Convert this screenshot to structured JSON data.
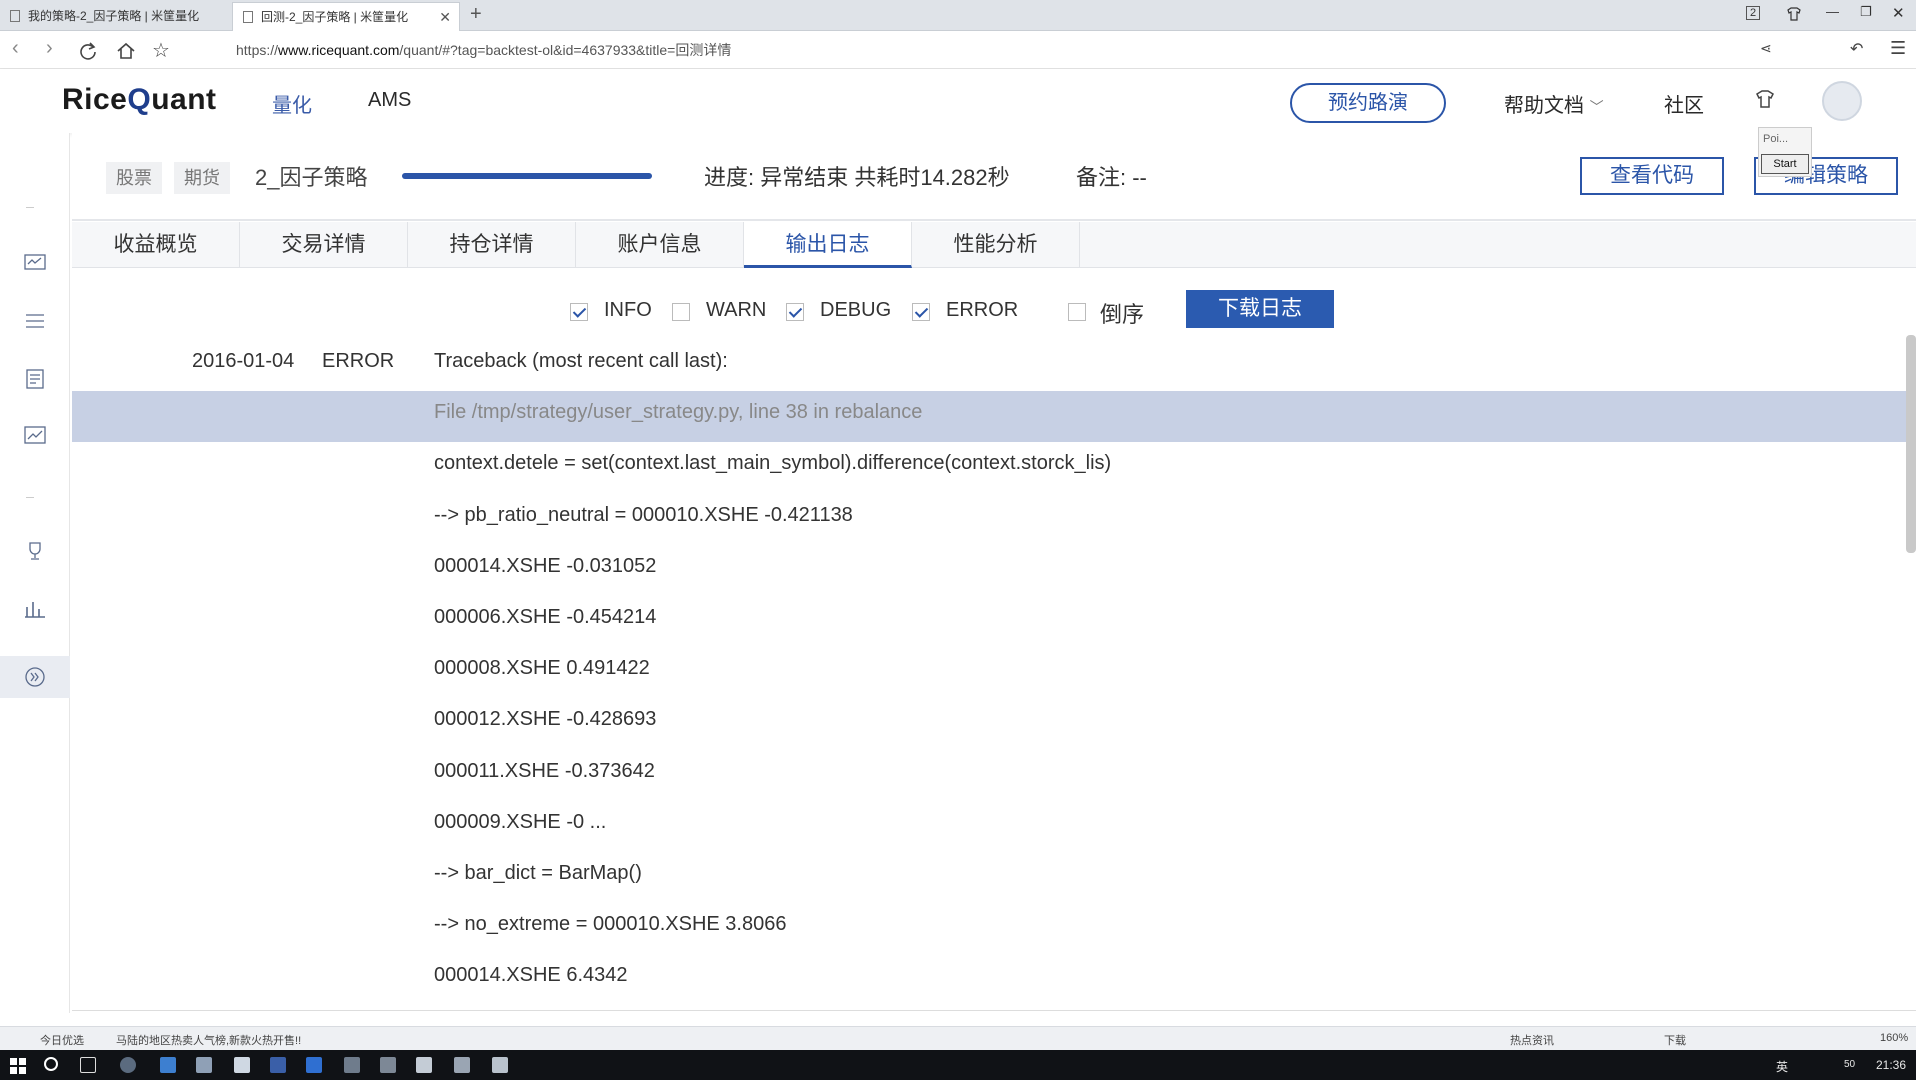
{
  "browser": {
    "tabs": [
      {
        "title": "我的策略-2_因子策略 | 米筐量化",
        "active": false
      },
      {
        "title": "回测-2_因子策略 | 米筐量化",
        "active": true
      }
    ],
    "url_prefix": "https://",
    "url_domain": "www.ricequant.com",
    "url_rest": "/quant/#?tag=backtest-ol&id=4637933&title=回测详情",
    "win_badge": "2"
  },
  "header": {
    "logo_rice": "Rice",
    "logo_q": "Q",
    "logo_uant": "uant",
    "nav": [
      "量化",
      "AMS"
    ],
    "demo_button": "预约路演",
    "help_docs": "帮助文档",
    "community": "社区"
  },
  "overlay_widget": {
    "top_label": "Poi...",
    "button": "Start"
  },
  "strategy": {
    "type_stock": "股票",
    "type_futures": "期货",
    "name": "2_因子策略",
    "progress_fraction": 1.0,
    "progress_text": "进度: 异常结束 共耗时14.282秒",
    "remark": "备注: --",
    "view_code": "查看代码",
    "edit_strategy": "编辑策略"
  },
  "tabs": [
    {
      "label": "收益概览",
      "active": false
    },
    {
      "label": "交易详情",
      "active": false
    },
    {
      "label": "持仓详情",
      "active": false
    },
    {
      "label": "账户信息",
      "active": false
    },
    {
      "label": "输出日志",
      "active": true
    },
    {
      "label": "性能分析",
      "active": false
    }
  ],
  "filters": [
    {
      "label": "INFO",
      "checked": true
    },
    {
      "label": "WARN",
      "checked": false
    },
    {
      "label": "DEBUG",
      "checked": true
    },
    {
      "label": "ERROR",
      "checked": true
    },
    {
      "label": "倒序",
      "checked": false
    }
  ],
  "download_button": "下载日志",
  "log": [
    {
      "date": "2016-01-04",
      "level": "ERROR",
      "message": "Traceback (most recent call last):",
      "highlight": false
    },
    {
      "date": "",
      "level": "",
      "message": "File /tmp/strategy/user_strategy.py, line 38 in rebalance",
      "highlight": true
    },
    {
      "date": "",
      "level": "",
      "message": "context.detele = set(context.last_main_symbol).difference(context.storck_lis)",
      "highlight": false
    },
    {
      "date": "",
      "level": "",
      "message": "--> pb_ratio_neutral = 000010.XSHE -0.421138",
      "highlight": false
    },
    {
      "date": "",
      "level": "",
      "message": "000014.XSHE -0.031052",
      "highlight": false
    },
    {
      "date": "",
      "level": "",
      "message": "000006.XSHE -0.454214",
      "highlight": false
    },
    {
      "date": "",
      "level": "",
      "message": "000008.XSHE 0.491422",
      "highlight": false
    },
    {
      "date": "",
      "level": "",
      "message": "000012.XSHE -0.428693",
      "highlight": false
    },
    {
      "date": "",
      "level": "",
      "message": "000011.XSHE -0.373642",
      "highlight": false
    },
    {
      "date": "",
      "level": "",
      "message": "000009.XSHE -0 ...",
      "highlight": false
    },
    {
      "date": "",
      "level": "",
      "message": "--> bar_dict = BarMap()",
      "highlight": false
    },
    {
      "date": "",
      "level": "",
      "message": "--> no_extreme = 000010.XSHE 3.8066",
      "highlight": false
    },
    {
      "date": "",
      "level": "",
      "message": "000014.XSHE 6.4342",
      "highlight": false
    }
  ],
  "statusbar": {
    "left_label": "今日优选",
    "news": "马陆的地区热卖人气榜,新款火热开售!!",
    "hot_news": "热点资讯",
    "download": "下载",
    "zoom": "160%"
  },
  "taskbar": {
    "ime": "英",
    "battery": "50",
    "time": "21:36"
  },
  "colors": {
    "brand": "#2b55a8",
    "highlight_row": "#c7d0e4",
    "download_button": "#2b5bb0"
  }
}
